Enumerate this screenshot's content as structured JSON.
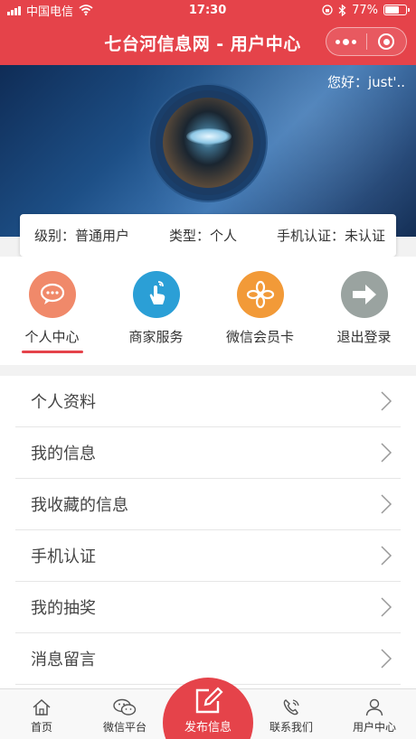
{
  "status_bar": {
    "carrier": "中国电信",
    "time": "17:30",
    "battery": "77%",
    "battery_level": 0.77
  },
  "nav": {
    "title": "七台河信息网 - 用户中心"
  },
  "banner": {
    "greeting": "您好：just'.."
  },
  "info": {
    "level_label": "级别：",
    "level_value": "普通用户",
    "type_label": "类型：",
    "type_value": "个人",
    "phone_label": "手机认证：",
    "phone_value": "未认证"
  },
  "quick_menu": [
    {
      "label": "个人中心",
      "icon": "chat-bubble-icon",
      "color": "#f0896a",
      "active": true
    },
    {
      "label": "商家服务",
      "icon": "hand-touch-icon",
      "color": "#2b9fd6",
      "active": false
    },
    {
      "label": "微信会员卡",
      "icon": "flower-icon",
      "color": "#f29a38",
      "active": false
    },
    {
      "label": "退出登录",
      "icon": "arrow-right-icon",
      "color": "#9aa3a0",
      "active": false
    }
  ],
  "list": [
    {
      "label": "个人资料"
    },
    {
      "label": "我的信息"
    },
    {
      "label": "我收藏的信息"
    },
    {
      "label": "手机认证"
    },
    {
      "label": "我的抽奖"
    },
    {
      "label": "消息留言"
    }
  ],
  "tabbar": {
    "home": "首页",
    "wechat": "微信平台",
    "publish": "发布信息",
    "contact": "联系我们",
    "user": "用户中心"
  },
  "colors": {
    "brand": "#e5434a"
  }
}
